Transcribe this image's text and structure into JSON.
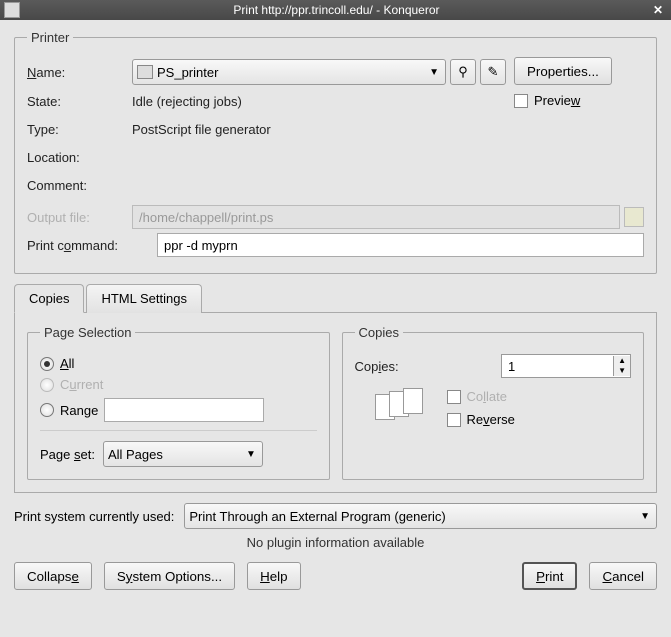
{
  "window": {
    "title": "Print http://ppr.trincoll.edu/ - Konqueror"
  },
  "printer": {
    "legend": "Printer",
    "name_label": "Name:",
    "name_value": "PS_printer",
    "state_label": "State:",
    "state_value": "Idle (rejecting jobs)",
    "type_label": "Type:",
    "type_value": "PostScript file generator",
    "location_label": "Location:",
    "location_value": "",
    "comment_label": "Comment:",
    "comment_value": "",
    "output_label": "Output file:",
    "output_value": "/home/chappell/print.ps",
    "command_label": "Print command:",
    "command_value": "ppr -d myprn",
    "properties_btn": "Properties...",
    "preview_label": "Preview"
  },
  "tabs": {
    "copies": "Copies",
    "html_settings": "HTML Settings"
  },
  "page_selection": {
    "legend": "Page Selection",
    "all": "All",
    "current": "Current",
    "range": "Range",
    "range_value": "",
    "page_set_label": "Page set:",
    "page_set_value": "All Pages"
  },
  "copies": {
    "legend": "Copies",
    "copies_label": "Copies:",
    "copies_value": "1",
    "collate": "Collate",
    "reverse": "Reverse"
  },
  "system": {
    "label": "Print system currently used:",
    "value": "Print Through an External Program (generic)",
    "no_plugin": "No plugin information available"
  },
  "footer": {
    "collapse": "Collapse",
    "system_options": "System Options...",
    "help": "Help",
    "print": "Print",
    "cancel": "Cancel"
  }
}
